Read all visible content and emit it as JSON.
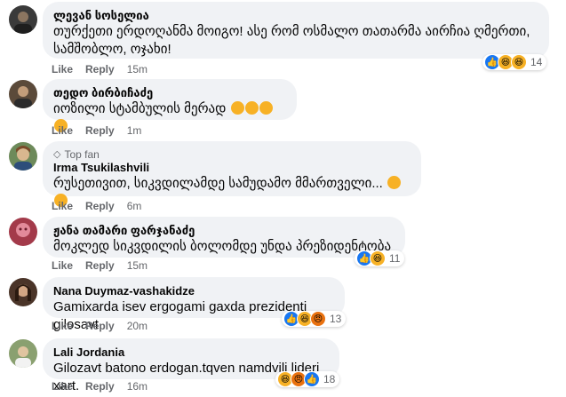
{
  "labels": {
    "like": "Like",
    "reply": "Reply",
    "top_fan": "Top fan"
  },
  "colors": {
    "bubble": "#f0f2f5",
    "meta": "#65676b",
    "like_blue": "#1877f2",
    "haha_yellow": "#f7b125",
    "angry_orange": "#e9710f"
  },
  "comments": [
    {
      "author": "ლევან სოსელია",
      "text_line1": "თურქეთი ერდოღანმა მოიგო! ასე რომ ოსმალო თათარმა აირჩია ღმერთი,",
      "text_line2": "სამშობლო, ოჯახი!",
      "time": "15m",
      "reactions": [
        "like-icon",
        "haha-icon",
        "haha-icon"
      ],
      "reaction_count": "14"
    },
    {
      "author": "თედო ბირბიჩაძე",
      "text_line1": "იოზილი სტამბულის მერად",
      "emoji_count": 4,
      "time": "1m"
    },
    {
      "badge": "Top fan",
      "author": "Irma Tsukilashvili",
      "text_line1": "რუსეთივით, სიკვდილამდე სამუდამო მმართველი...",
      "time": "6m"
    },
    {
      "author": "ჟანა თამარი ფარჯანაძე",
      "text_line1": "მოკლედ სიკვდილის ბოლომდე უნდა პრეზიდენტობა",
      "time": "15m",
      "reactions": [
        "like-icon",
        "haha-icon"
      ],
      "reaction_count": "11"
    },
    {
      "author": "Nana Duymaz-vashakidze",
      "text_line1": "Gamixarda isev ergogami gaxda prezidenti gilosavt",
      "time": "20m",
      "reactions": [
        "like-icon",
        "haha-icon",
        "angry-icon"
      ],
      "reaction_count": "13"
    },
    {
      "author": "Lali Jordania",
      "text_line1": "Gilozavt batono erdogan.tqven namdvili lideri xart.",
      "time": "16m",
      "reactions": [
        "haha-icon",
        "angry-icon",
        "like-icon"
      ],
      "reaction_count": "18"
    }
  ]
}
